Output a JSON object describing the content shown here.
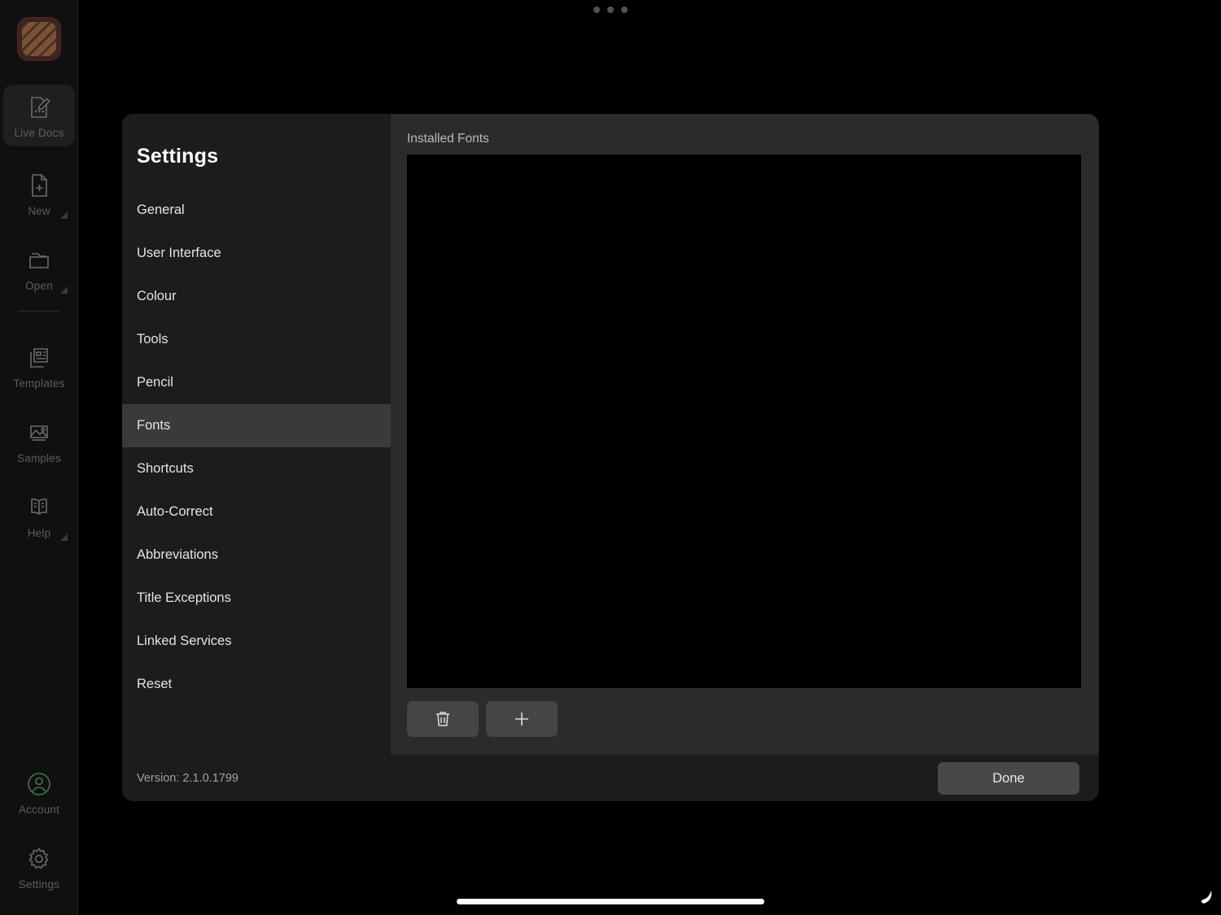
{
  "window_chrome": {
    "top_dots_count": 3,
    "home_indicator": "home-indicator",
    "pen_cursor": "pen-cursor"
  },
  "rail": {
    "logo_name": "app-logo",
    "items": [
      {
        "label": "Live Docs",
        "icon": "document-pencil-icon",
        "active": true,
        "has_submenu": false
      },
      {
        "label": "New",
        "icon": "document-plus-icon",
        "active": false,
        "has_submenu": true
      },
      {
        "label": "Open",
        "icon": "folder-icon",
        "active": false,
        "has_submenu": true
      },
      {
        "label": "Templates",
        "icon": "templates-icon",
        "active": false,
        "has_submenu": false
      },
      {
        "label": "Samples",
        "icon": "image-icon",
        "active": false,
        "has_submenu": false
      },
      {
        "label": "Help",
        "icon": "book-icon",
        "active": false,
        "has_submenu": true
      },
      {
        "label": "Account",
        "icon": "account-icon",
        "active": false,
        "has_submenu": false
      },
      {
        "label": "Settings",
        "icon": "gear-icon",
        "active": false,
        "has_submenu": false
      }
    ]
  },
  "settings": {
    "title": "Settings",
    "nav_items": [
      {
        "label": "General",
        "selected": false
      },
      {
        "label": "User Interface",
        "selected": false
      },
      {
        "label": "Colour",
        "selected": false
      },
      {
        "label": "Tools",
        "selected": false
      },
      {
        "label": "Pencil",
        "selected": false
      },
      {
        "label": "Fonts",
        "selected": true
      },
      {
        "label": "Shortcuts",
        "selected": false
      },
      {
        "label": "Auto-Correct",
        "selected": false
      },
      {
        "label": "Abbreviations",
        "selected": false
      },
      {
        "label": "Title Exceptions",
        "selected": false
      },
      {
        "label": "Linked Services",
        "selected": false
      },
      {
        "label": "Reset",
        "selected": false
      }
    ],
    "version": "Version: 2.1.0.1799"
  },
  "fonts_panel": {
    "section_label": "Installed Fonts",
    "list_items": [],
    "delete_button": "trash-icon",
    "add_button": "plus-icon"
  },
  "footer": {
    "done_label": "Done"
  },
  "colors": {
    "page_background": "#000000",
    "rail_background": "#101010",
    "left_pane": "#1c1c1c",
    "right_pane": "#2b2b2b",
    "list_background": "#000000",
    "selected_row": "#3a3a3a",
    "button": "#454545",
    "accent_account": "#3e7a4e",
    "logo_brown": "#7a5334"
  }
}
